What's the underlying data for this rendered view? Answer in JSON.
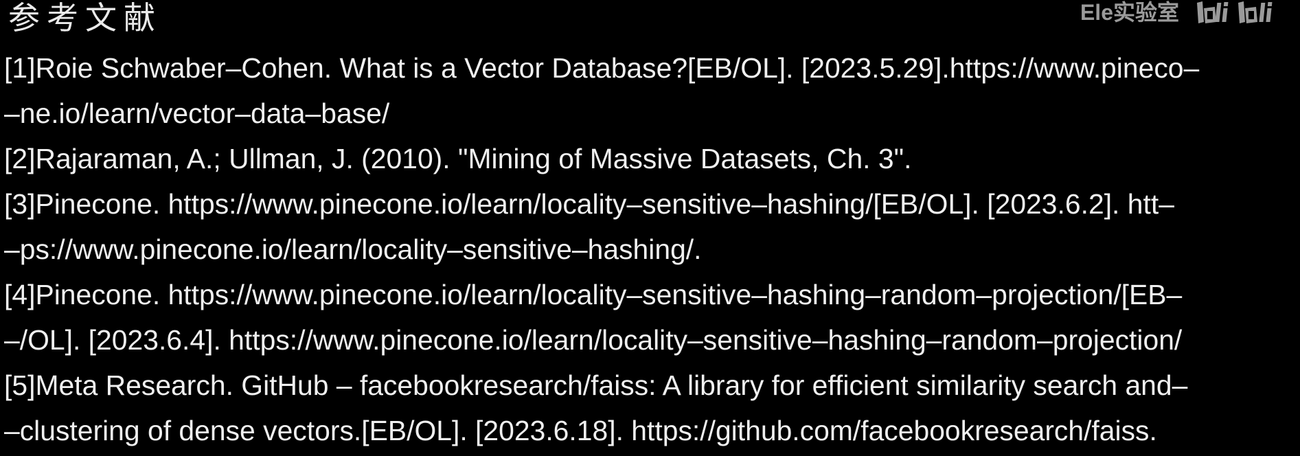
{
  "heading": "参考文献",
  "watermark": {
    "channel": "Ele实验室",
    "logo_icon": "bilibili-logo-icon",
    "logo_text": "bilibili"
  },
  "references": [
    {
      "lines": [
        "[1]Roie Schwaber–Cohen. What is a Vector Database?[EB/OL]. [2023.5.29].https://www.pineco–",
        "–ne.io/learn/vector–data–base/"
      ]
    },
    {
      "lines": [
        "[2]Rajaraman, A.; Ullman, J. (2010). \"Mining of Massive Datasets, Ch. 3\"."
      ]
    },
    {
      "lines": [
        "[3]Pinecone. https://www.pinecone.io/learn/locality–sensitive–hashing/[EB/OL]. [2023.6.2]. htt–",
        "–ps://www.pinecone.io/learn/locality–sensitive–hashing/."
      ]
    },
    {
      "lines": [
        "[4]Pinecone. https://www.pinecone.io/learn/locality–sensitive–hashing–random–projection/[EB–",
        "–/OL]. [2023.6.4]. https://www.pinecone.io/learn/locality–sensitive–hashing–random–projection/"
      ]
    },
    {
      "lines": [
        "[5]Meta Research. GitHub – facebookresearch/faiss: A library for efficient similarity search and–",
        "–clustering of dense vectors.[EB/OL]. [2023.6.18]. https://github.com/facebookresearch/faiss."
      ]
    }
  ]
}
